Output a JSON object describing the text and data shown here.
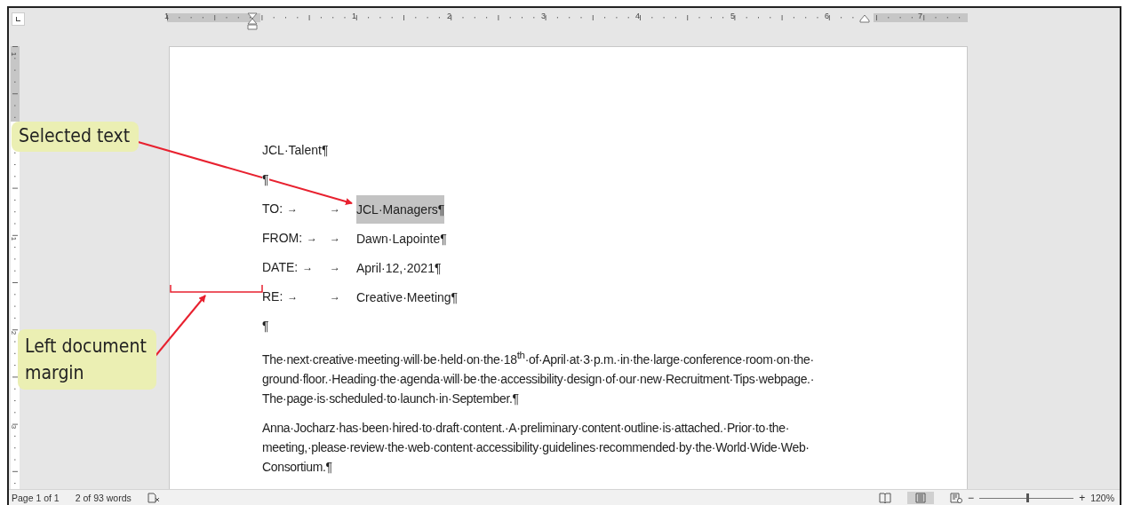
{
  "ruler": {
    "labels": [
      "1",
      "1",
      "2",
      "3",
      "4",
      "5",
      "6",
      "7"
    ]
  },
  "vertical_ruler": {
    "labels": [
      "1",
      "1",
      "2",
      "3"
    ]
  },
  "document": {
    "lines": [
      {
        "kind": "text",
        "text": "JCL·Talent¶"
      },
      {
        "kind": "text",
        "text": "¶"
      },
      {
        "kind": "memo",
        "label": "TO:",
        "tab_marks": [
          "→",
          "→"
        ],
        "value": "JCL·Managers¶",
        "selected": true
      },
      {
        "kind": "memo",
        "label": "FROM:",
        "tab_marks": [
          "→",
          "→"
        ],
        "value": "Dawn·Lapointe¶",
        "selected": false
      },
      {
        "kind": "memo",
        "label": "DATE:",
        "tab_marks": [
          "→",
          "→"
        ],
        "value": "April·12,·2021¶",
        "selected": false
      },
      {
        "kind": "memo",
        "label": "RE:",
        "tab_marks": [
          "→",
          "→"
        ],
        "value": "Creative·Meeting¶",
        "selected": false
      },
      {
        "kind": "text",
        "text": "¶"
      },
      {
        "kind": "paragraph",
        "lines": [
          "The·next·creative·meeting·will·be·held·on·the·18$^{th}$·of·April·at·3·p.m.·in·the·large·conference·room·on·the·",
          "ground·floor.·Heading·the·agenda·will·be·the·accessibility·design·of·our·new·Recruitment·Tips·webpage.·",
          "The·page·is·scheduled·to·launch·in·September.¶"
        ]
      },
      {
        "kind": "paragraph",
        "lines": [
          "Anna·Jocharz·has·been·hired·to·draft·content.·A·preliminary·content·outline·is·attached.·Prior·to·the·",
          "meeting,·please·review·the·web·content·accessibility·guidelines·recommended·by·the·World·Wide·Web·",
          "Consortium.¶"
        ]
      }
    ]
  },
  "callouts": [
    {
      "text": "Selected text"
    },
    {
      "text": "Left document margin"
    }
  ],
  "status_bar": {
    "page": "Page 1 of 1",
    "words": "2 of 93 words",
    "zoom": {
      "out": "−",
      "in": "+",
      "level": 0.51,
      "reading": "120%"
    }
  }
}
